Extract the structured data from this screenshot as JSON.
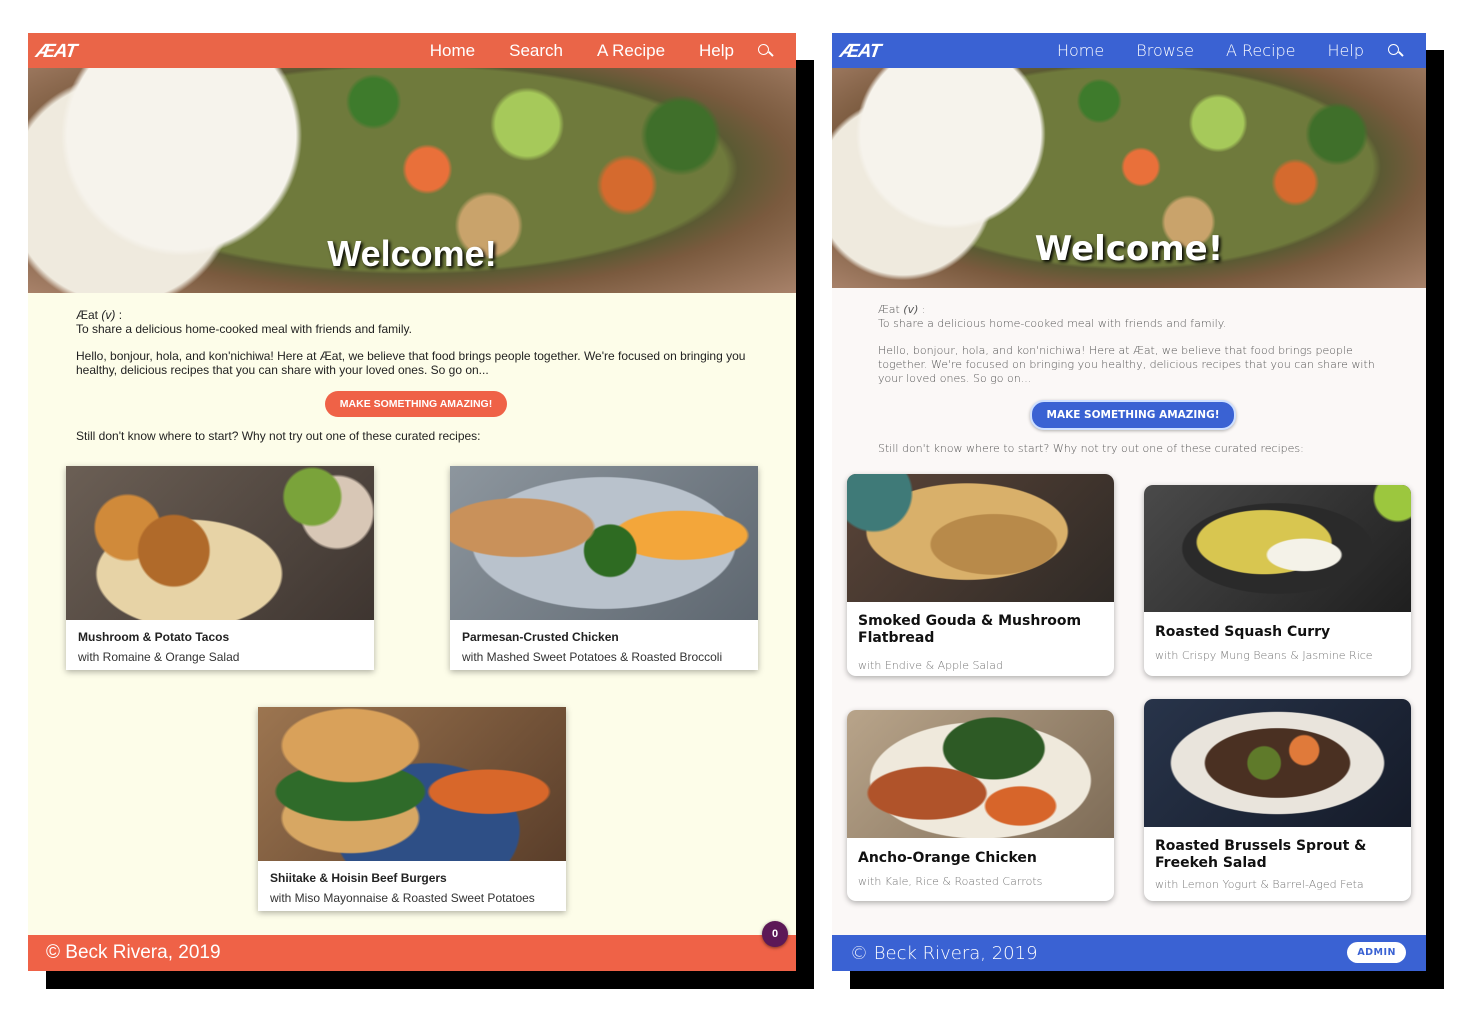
{
  "left": {
    "logo": "ÆAT",
    "nav": [
      "Home",
      "Search",
      "A Recipe",
      "Help"
    ],
    "hero_title": "Welcome!",
    "definition_word": "Æat",
    "definition_pos": "(v)",
    "definition_colon": " :",
    "definition_text": "To share a delicious home-cooked meal with friends and family.",
    "intro": "Hello, bonjour, hola, and kon'nichiwa! Here at Æat, we believe that food brings people together. We're focused on bringing you healthy, delicious recipes that you can share with your loved ones. So go on...",
    "cta": "MAKE SOMETHING AMAZING!",
    "curated": "Still don't know where to start? Why not try out one of these curated recipes:",
    "cards": [
      {
        "title": "Mushroom & Potato Tacos",
        "subtitle": "with Romaine & Orange Salad"
      },
      {
        "title": "Parmesan-Crusted Chicken",
        "subtitle": "with Mashed Sweet Potatoes & Roasted Broccoli"
      },
      {
        "title": "Shiitake & Hoisin Beef Burgers",
        "subtitle": "with Miso Mayonnaise & Roasted Sweet Potatoes"
      }
    ],
    "footer": "© Beck Rivera, 2019",
    "badge": "0",
    "accent": "#ef6247"
  },
  "right": {
    "logo": "ÆAT",
    "nav": [
      "Home",
      "Browse",
      "A Recipe",
      "Help"
    ],
    "hero_title": "Welcome!",
    "definition_word": "Æat",
    "definition_pos": "(v)",
    "definition_colon": " :",
    "definition_text": "To share a delicious home-cooked meal with friends and family.",
    "intro": "Hello, bonjour, hola, and kon'nichiwa! Here at Æat, we believe that food brings people together. We're focused on bringing you healthy, delicious recipes that you can share with your loved ones. So go on...",
    "cta": "MAKE SOMETHING AMAZING!",
    "curated": "Still don't know where to start? Why not try out one of these curated recipes:",
    "cards": [
      {
        "title": "Smoked Gouda & Mushroom Flatbread",
        "subtitle": "with Endive & Apple Salad"
      },
      {
        "title": "Roasted Squash Curry",
        "subtitle": "with Crispy Mung Beans & Jasmine Rice"
      },
      {
        "title": "Ancho-Orange Chicken",
        "subtitle": "with Kale, Rice & Roasted Carrots"
      },
      {
        "title": "Roasted Brussels Sprout & Freekeh Salad",
        "subtitle": "with Lemon Yogurt & Barrel-Aged Feta"
      }
    ],
    "footer": "© Beck Rivera, 2019",
    "admin": "ADMIN",
    "accent": "#3a62d3"
  }
}
